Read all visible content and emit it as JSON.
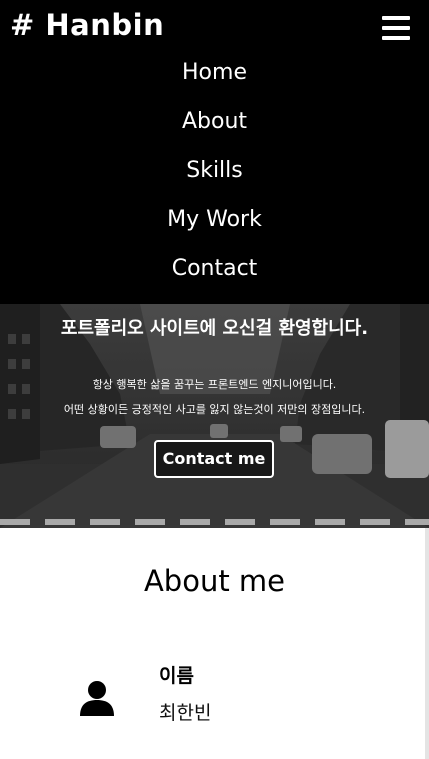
{
  "navbar": {
    "logo": "# Hanbin",
    "menu_icon": "hamburger-menu-icon",
    "menu_items": [
      {
        "label": "Home"
      },
      {
        "label": "About"
      },
      {
        "label": "Skills"
      },
      {
        "label": "My Work"
      },
      {
        "label": "Contact"
      }
    ]
  },
  "hero": {
    "title": "포트폴리오 사이트에 오신걸 환영합니다.",
    "description_line1": "항상 행복한 삶을 꿈꾸는 프론트엔드 엔지니어입니다.",
    "description_line2": "어떤 상황이든 긍정적인 사고를 잃지 않는것이 저만의 장점입니다.",
    "contact_button": "Contact me",
    "background": "city-street-photo"
  },
  "about": {
    "title": "About me",
    "info": {
      "icon": "person-icon",
      "label": "이름",
      "value": "최한빈"
    }
  },
  "colors": {
    "navbar_bg": "#000000",
    "text_light": "#ffffff",
    "text_dark": "#000000"
  }
}
